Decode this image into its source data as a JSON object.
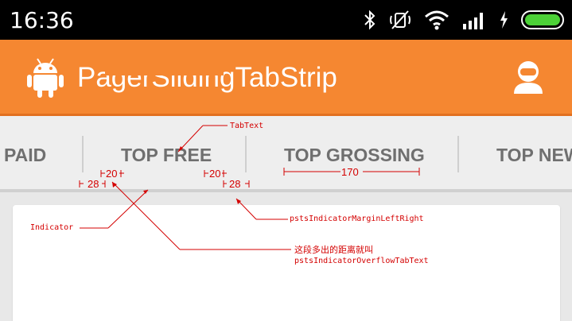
{
  "status_bar": {
    "time": "16:36",
    "icons": [
      "bluetooth-icon",
      "mute-icon",
      "wifi-icon",
      "signal-icon",
      "charging-icon",
      "battery-icon"
    ],
    "battery_color": "#4cd137"
  },
  "app_bar": {
    "title": "PagerSlidingTabStrip",
    "logo_icon": "android-logo-icon",
    "action_icon": "profile-icon",
    "background_color": "#f58731"
  },
  "tabs": [
    {
      "label": "PAID"
    },
    {
      "label": "TOP FREE",
      "selected": true
    },
    {
      "label": "TOP GROSSING"
    },
    {
      "label": "TOP NEW"
    }
  ],
  "annotations": {
    "tab_text": "TabText",
    "indicator": "Indicator",
    "margin_left_right": "pstsIndicatorMarginLeftRight",
    "overflow_desc": "这段多出的距离就叫",
    "overflow_name": "pstsIndicatorOverflowTabText",
    "dim_left": "28",
    "dim_right": "28",
    "overflow_left": "20",
    "overflow_right": "20",
    "tab_width": "170",
    "color": "#d40000"
  }
}
